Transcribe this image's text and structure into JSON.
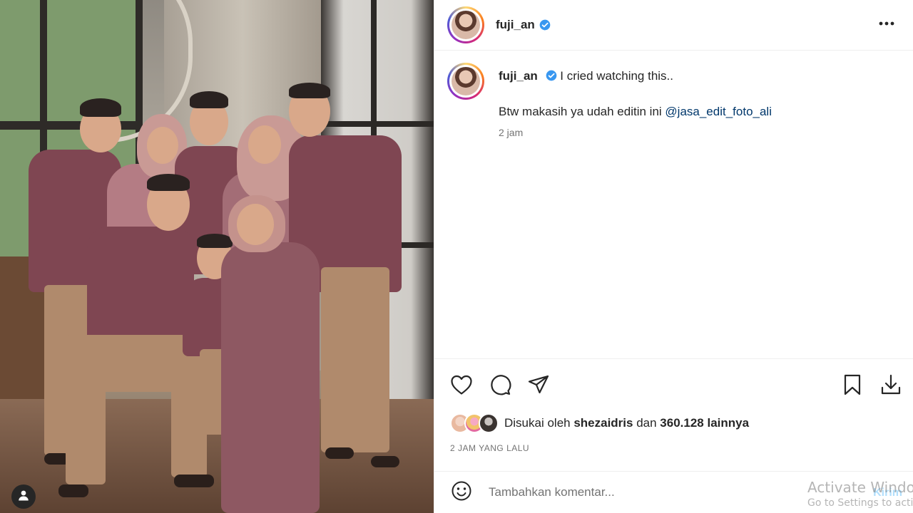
{
  "post": {
    "username": "fuji_an",
    "caption_text": "I cried watching this..",
    "caption_line2_prefix": "Btw makasih ya udah editin ini ",
    "caption_mention": "@jasa_edit_foto_ali",
    "caption_time": "2 jam",
    "likes_prefix": "Disukai oleh ",
    "likes_user": "shezaidris",
    "likes_middle": " dan ",
    "likes_count": "360.128 lainnya",
    "timestamp": "2 JAM YANG LALU",
    "comment_placeholder": "Tambahkan komentar...",
    "post_button": "Kirim"
  },
  "icons": {
    "verified": "verified-badge-icon",
    "more": "more-options-icon",
    "like": "heart-icon",
    "comment": "comment-icon",
    "share": "send-icon",
    "save": "bookmark-icon",
    "download": "download-icon",
    "emoji": "emoji-icon",
    "user_tag": "user-icon"
  },
  "colors": {
    "verified_blue": "#3897f0",
    "mention": "#00376b",
    "muted": "#737373",
    "post_button_disabled": "#b2dffc"
  },
  "watermark": {
    "line1": "Activate Windows",
    "line2": "Go to Settings to activate Windows."
  }
}
